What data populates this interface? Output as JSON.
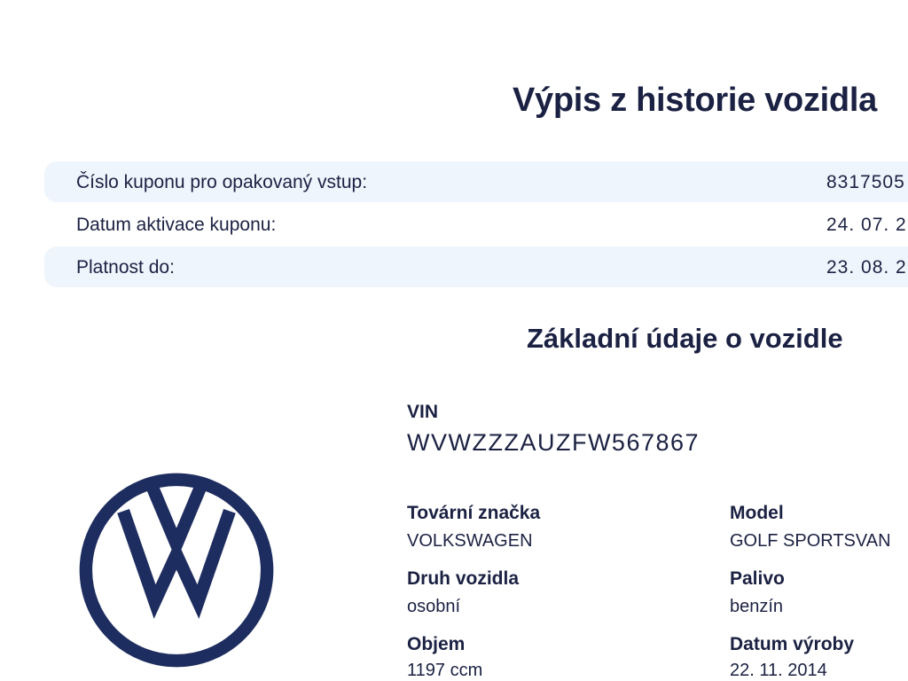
{
  "title": "Výpis z historie vozidla",
  "coupon": {
    "rows": [
      {
        "label": "Číslo kuponu pro opakovaný vstup:",
        "value": "8317505"
      },
      {
        "label": "Datum aktivace kuponu:",
        "value": "24. 07. 2"
      },
      {
        "label": "Platnost do:",
        "value": "23. 08. 2"
      }
    ]
  },
  "basic": {
    "title": "Základní údaje o vozidle",
    "logo_icon": "volkswagen-logo-icon",
    "logo_color": "#1e2d5f",
    "vin_label": "VIN",
    "vin_value": "WVWZZZAUZFW567867",
    "fields": {
      "make": {
        "label": "Tovární značka",
        "value": "VOLKSWAGEN"
      },
      "model": {
        "label": "Model",
        "value": "GOLF SPORTSVAN"
      },
      "type": {
        "label": "Druh vozidla",
        "value": "osobní"
      },
      "fuel": {
        "label": "Palivo",
        "value": "benzín"
      },
      "volume": {
        "label": "Objem",
        "value": "1197 ccm"
      },
      "production_date": {
        "label": "Datum výroby",
        "value": "22. 11. 2014"
      }
    }
  }
}
